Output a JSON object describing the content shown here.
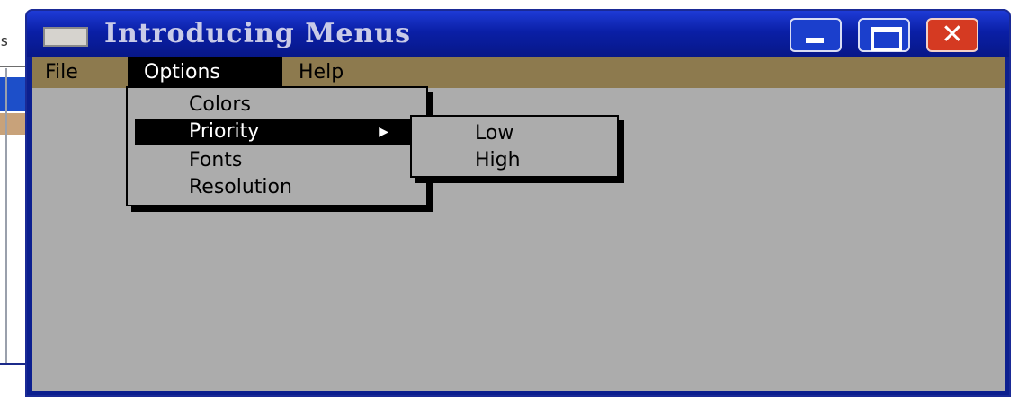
{
  "window": {
    "title": "Introducing Menus",
    "title_icon": "window-icon",
    "controls": {
      "minimize_icon": "minimize-icon",
      "maximize_icon": "maximize-icon",
      "close_icon": "close-icon",
      "close_glyph": "✕"
    }
  },
  "background": {
    "fragment_text": "s"
  },
  "menubar": {
    "items": [
      {
        "label": "File"
      },
      {
        "label": "Options",
        "active": true
      },
      {
        "label": "Help"
      }
    ]
  },
  "options_menu": {
    "items": [
      {
        "label": "Colors"
      },
      {
        "label": "Priority",
        "selected": true,
        "has_submenu": true,
        "arrow_glyph": "▶"
      },
      {
        "label": "Fonts"
      },
      {
        "label": "Resolution"
      }
    ]
  },
  "priority_submenu": {
    "items": [
      {
        "label": "Low"
      },
      {
        "label": "High"
      }
    ]
  },
  "colors": {
    "titlebar": "#0a1fa6",
    "menubar": "#8d7a4e",
    "client": "#acacac",
    "selection": "#000000",
    "close_button": "#d53a22"
  }
}
